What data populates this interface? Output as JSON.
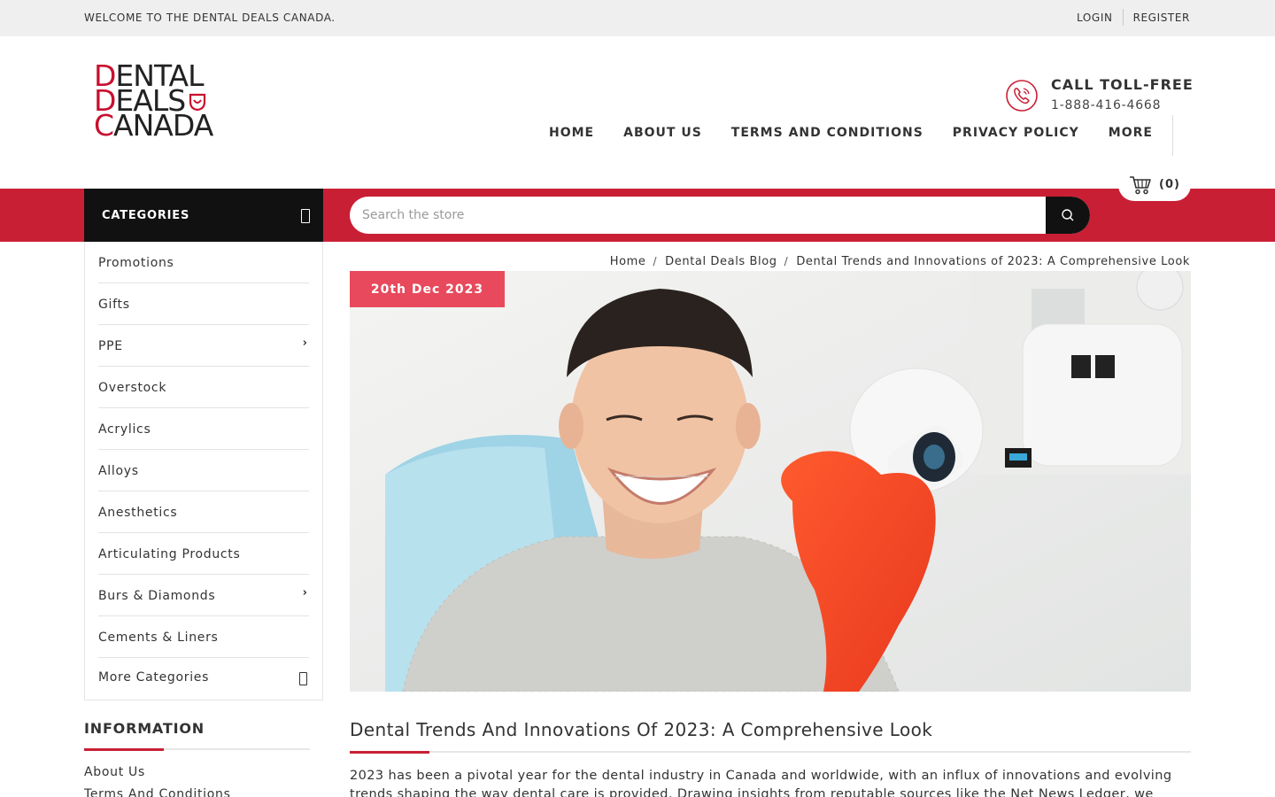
{
  "topbar": {
    "welcome": "WELCOME TO THE DENTAL DEALS CANADA.",
    "login": "LOGIN",
    "register": "REGISTER"
  },
  "logo": {
    "line1": "ENTAL",
    "line2": "EALS",
    "line3": "ANADA",
    "initial1": "D",
    "initial2": "D",
    "initial3": "C"
  },
  "contact": {
    "title": "CALL TOLL-FREE",
    "number": "1-888-416-4668"
  },
  "nav": {
    "items": [
      "HOME",
      "ABOUT US",
      "TERMS AND CONDITIONS",
      "PRIVACY POLICY",
      "MORE"
    ]
  },
  "categories_header": "CATEGORIES",
  "search": {
    "placeholder": "Search the store"
  },
  "cart": {
    "count": "(0)"
  },
  "categories": [
    {
      "label": "Promotions",
      "has_children": false
    },
    {
      "label": "Gifts",
      "has_children": false
    },
    {
      "label": "PPE",
      "has_children": true
    },
    {
      "label": "Overstock",
      "has_children": false
    },
    {
      "label": "Acrylics",
      "has_children": false
    },
    {
      "label": "Alloys",
      "has_children": false
    },
    {
      "label": "Anesthetics",
      "has_children": false
    },
    {
      "label": "Articulating Products",
      "has_children": false
    },
    {
      "label": "Burs & Diamonds",
      "has_children": true
    },
    {
      "label": "Cements & Liners",
      "has_children": false
    }
  ],
  "more_categories": "More Categories",
  "information": {
    "title": "INFORMATION",
    "links": [
      "About Us",
      "Terms And Conditions"
    ]
  },
  "breadcrumb": [
    "Home",
    "Dental Deals Blog",
    "Dental Trends and Innovations of 2023: A Comprehensive Look"
  ],
  "article": {
    "date": "20th Dec 2023",
    "title": "Dental Trends And Innovations Of 2023: A Comprehensive Look",
    "body": "2023 has been a pivotal year for the dental industry in Canada and worldwide, with an influx of innovations and evolving trends shaping the way dental care is provided. Drawing insights from reputable sources like the Net News Ledger, we"
  },
  "colors": {
    "brand_red": "#c91f35",
    "badge_red": "#e8495c",
    "dark": "#111111"
  }
}
